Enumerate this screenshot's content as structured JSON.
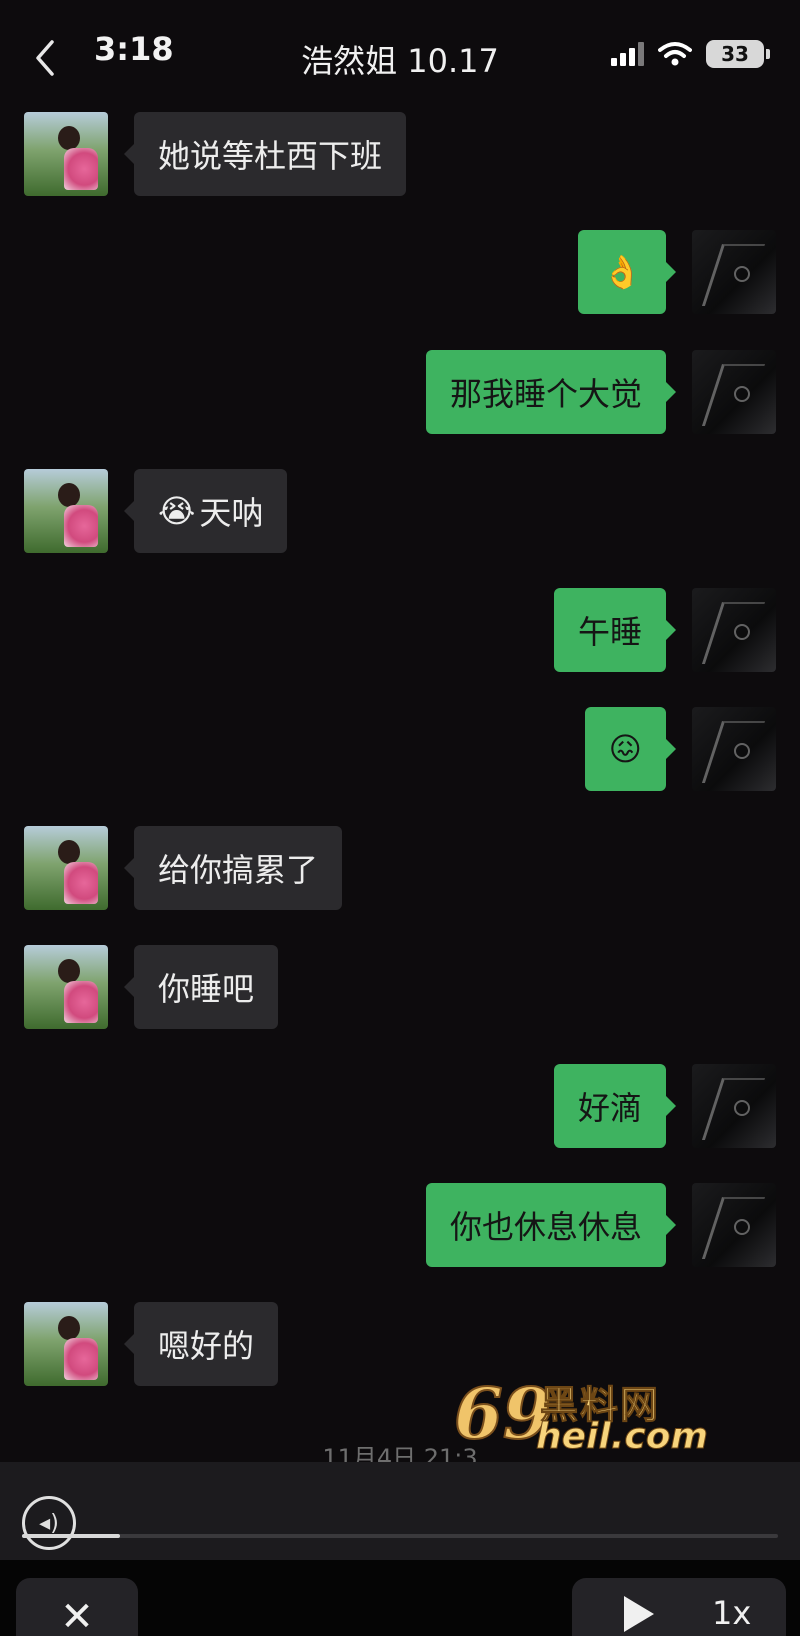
{
  "status": {
    "time": "3:18",
    "battery": "33"
  },
  "header": {
    "title": "浩然姐 10.17"
  },
  "messages": [
    {
      "from": "her",
      "text": "她说等杜西下班"
    },
    {
      "from": "me",
      "emoji": "👌"
    },
    {
      "from": "me",
      "text": "那我睡个大觉"
    },
    {
      "from": "her",
      "emoji": "😭",
      "text": "天呐"
    },
    {
      "from": "me",
      "text": "午睡"
    },
    {
      "from": "me",
      "emoji": "😖"
    },
    {
      "from": "her",
      "text": "给你搞累了"
    },
    {
      "from": "her",
      "text": "你睡吧"
    },
    {
      "from": "me",
      "text": "好滴"
    },
    {
      "from": "me",
      "text": "你也休息休息"
    },
    {
      "from": "her",
      "text": "嗯好的"
    }
  ],
  "date_separator": "11月4日 21:3",
  "watermark": {
    "number": "69",
    "chinese": "黑料网",
    "url": "heil.com"
  },
  "player": {
    "progress": 0.13,
    "speed": "1x"
  },
  "icons": {
    "back": "chevron-left-icon",
    "signal": "signal-icon",
    "wifi": "wifi-icon",
    "speaker": "speaker-icon",
    "close": "close-icon",
    "play": "play-icon"
  }
}
